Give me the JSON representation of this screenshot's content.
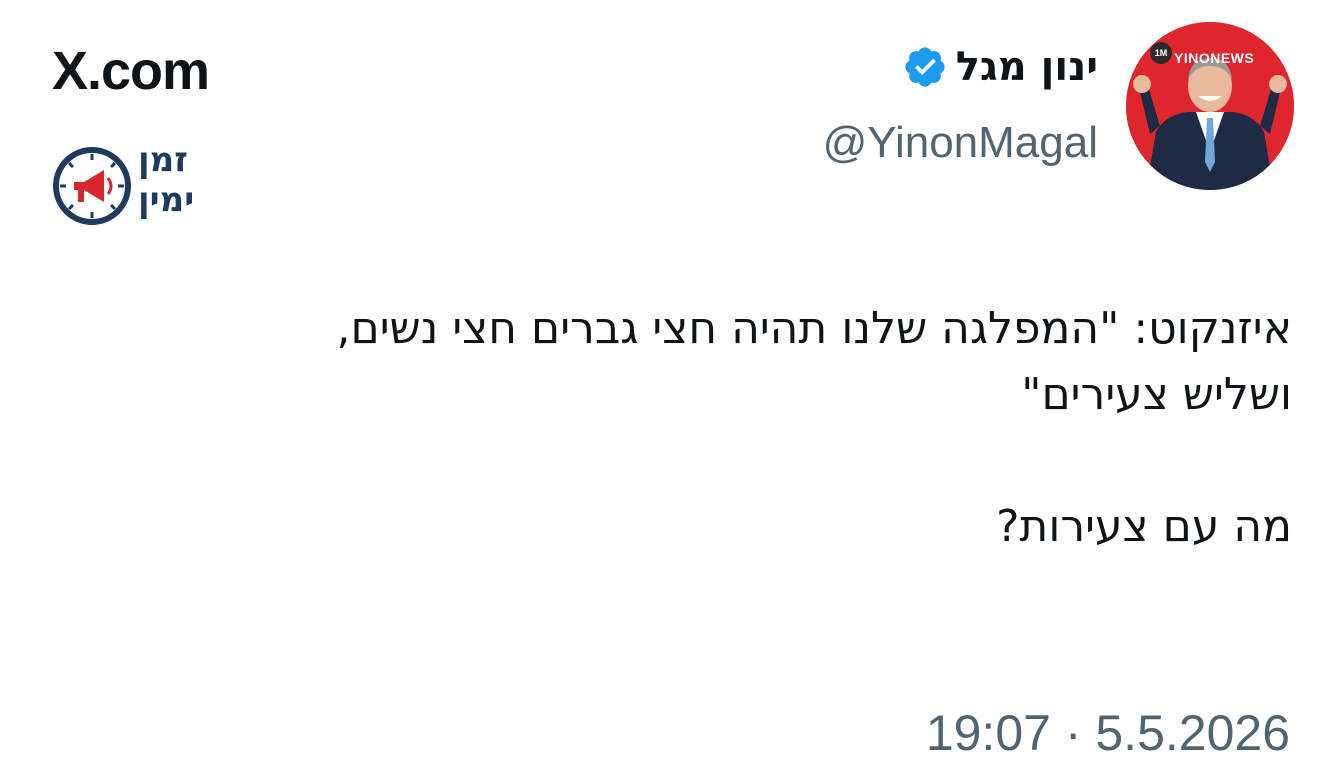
{
  "site": {
    "label": "X.com"
  },
  "brand_logo": {
    "line1": "זמן",
    "line2": "ימין",
    "icon": "clock-megaphone-icon"
  },
  "author": {
    "name": "ינון מגל",
    "handle": "@YinonMagal",
    "verified_icon": "verified-badge-icon",
    "avatar": {
      "badge": "YINONEWS",
      "badge_count": "1M",
      "background": "#e0262d"
    }
  },
  "tweet": {
    "line1": "איזנקוט: \"המפלגה שלנו תהיה חצי גברים חצי נשים,",
    "line2": "ושליש צעירים\"",
    "line3": "מה עם צעירות?",
    "timestamp": "19:07 · 5.5.2026"
  },
  "colors": {
    "text": "#0f1419",
    "secondary": "#536471",
    "verified": "#1d9bf0",
    "logo_navy": "#1e3a5f",
    "logo_red": "#d7262e"
  }
}
